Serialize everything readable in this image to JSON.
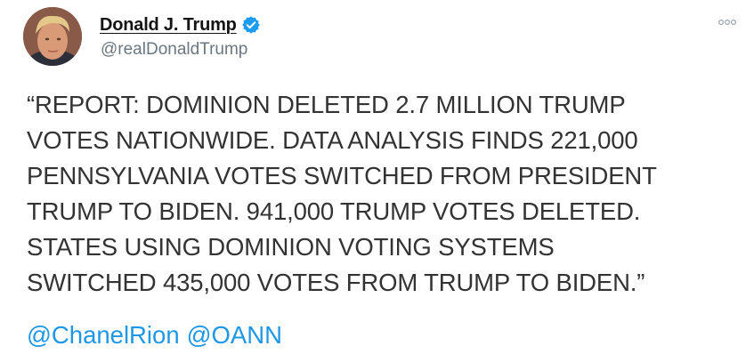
{
  "tweet": {
    "author": {
      "display_name": "Donald J. Trump",
      "handle": "@realDonaldTrump",
      "verified": true
    },
    "text_lines": [
      "“REPORT: DOMINION DELETED 2.7 MILLION TRUMP",
      "VOTES NATIONWIDE. DATA ANALYSIS FINDS 221,000",
      "PENNSYLVANIA VOTES SWITCHED FROM PRESIDENT",
      "TRUMP TO BIDEN. 941,000 TRUMP VOTES DELETED.",
      "STATES USING DOMINION VOTING SYSTEMS",
      "SWITCHED 435,000 VOTES FROM TRUMP TO BIDEN.”"
    ],
    "mentions": [
      "@ChanelRion",
      "@OANN"
    ]
  },
  "icons": {
    "verified": "verified-badge-icon",
    "more": "more-options-icon",
    "avatar": "profile-photo"
  },
  "colors": {
    "link": "#1d97e6",
    "verified_badge": "#1d9bf0",
    "body_text": "#333333",
    "handle_text": "#6b7780"
  }
}
